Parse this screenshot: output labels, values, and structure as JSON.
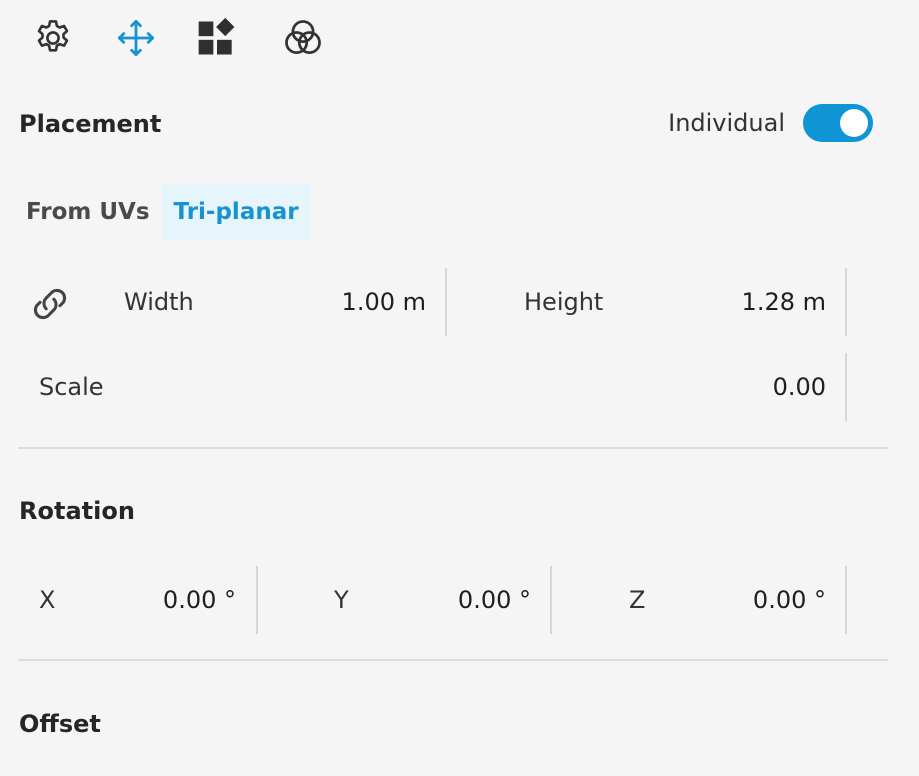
{
  "toolbar": {
    "icons": [
      "gear-icon",
      "move-icon",
      "shapes-icon",
      "color-channels-icon"
    ],
    "accent": "#1793d1"
  },
  "placement": {
    "title": "Placement",
    "toggle_label": "Individual",
    "toggle_on": true,
    "tabs": [
      {
        "label": "From UVs",
        "active": false
      },
      {
        "label": "Tri-planar",
        "active": true
      }
    ],
    "width_label": "Width",
    "width_value": "1.00 m",
    "height_label": "Height",
    "height_value": "1.28 m",
    "scale_label": "Scale",
    "scale_value": "0.00"
  },
  "rotation": {
    "title": "Rotation",
    "x_label": "X",
    "x_value": "0.00 °",
    "y_label": "Y",
    "y_value": "0.00 °",
    "z_label": "Z",
    "z_value": "0.00 °"
  },
  "offset": {
    "title": "Offset"
  },
  "colors": {
    "accent": "#0f95d6",
    "active_tab_bg": "#e6f4fb",
    "background": "#f5f5f5"
  }
}
